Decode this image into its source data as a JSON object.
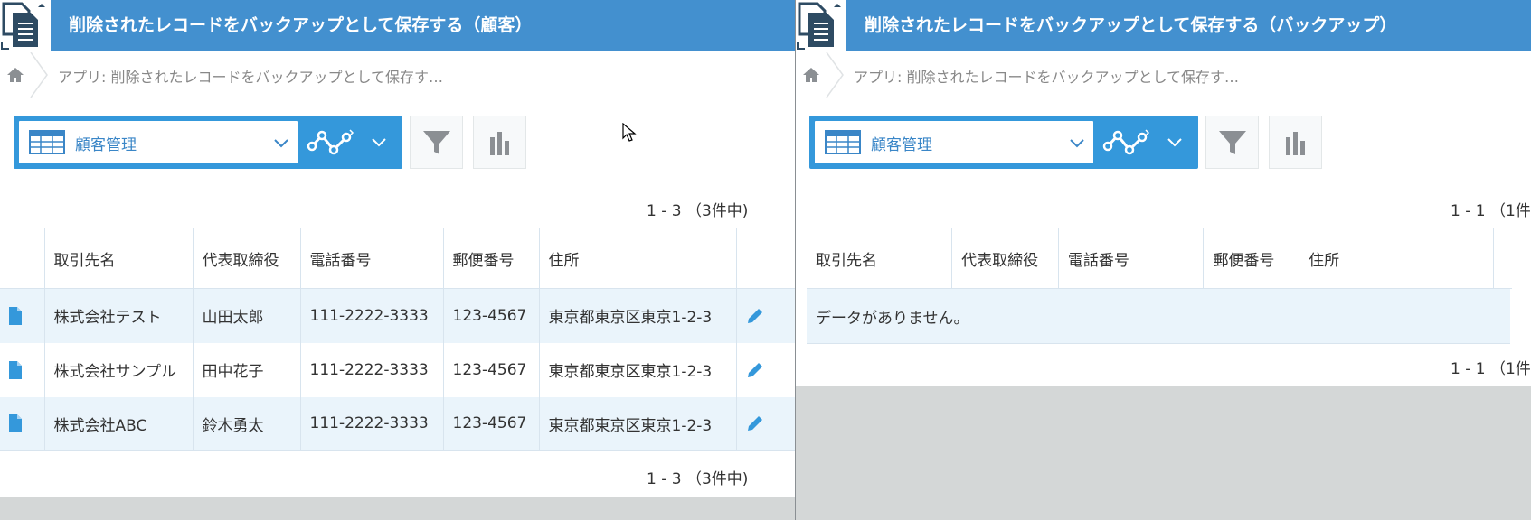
{
  "colors": {
    "header": "#4390cf",
    "accent": "#3498db",
    "row_alt": "#eaf4fb",
    "empty_bg": "#d4d7d7"
  },
  "left": {
    "title": "削除されたレコードをバックアップとして保存する（顧客）",
    "breadcrumb": "アプリ: 削除されたレコードをバックアップとして保存す…",
    "view_name": "顧客管理",
    "pager_top": "1 - 3 （3件中)",
    "pager_bottom": "1 - 3 （3件中)",
    "columns": [
      "取引先名",
      "代表取締役",
      "電話番号",
      "郵便番号",
      "住所"
    ],
    "rows": [
      {
        "company": "株式会社テスト",
        "ceo": "山田太郎",
        "phone": "111-2222-3333",
        "zip": "123-4567",
        "address": "東京都東京区東京1-2-3"
      },
      {
        "company": "株式会社サンプル",
        "ceo": "田中花子",
        "phone": "111-2222-3333",
        "zip": "123-4567",
        "address": "東京都東京区東京1-2-3"
      },
      {
        "company": "株式会社ABC",
        "ceo": "鈴木勇太",
        "phone": "111-2222-3333",
        "zip": "123-4567",
        "address": "東京都東京区東京1-2-3"
      }
    ]
  },
  "right": {
    "title": "削除されたレコードをバックアップとして保存する（バックアップ）",
    "breadcrumb": "アプリ: 削除されたレコードをバックアップとして保存す…",
    "view_name": "顧客管理",
    "pager_top": "1 - 1 （1件",
    "pager_bottom": "1 - 1 （1件",
    "columns": [
      "取引先名",
      "代表取締役",
      "電話番号",
      "郵便番号",
      "住所"
    ],
    "empty_message": "データがありません。"
  },
  "icons": [
    "app-icon",
    "home-icon",
    "table-view-icon",
    "chevron-down-icon",
    "graph-icon",
    "filter-icon",
    "bar-chart-icon",
    "document-icon",
    "pencil-icon",
    "mouse-cursor-icon"
  ]
}
